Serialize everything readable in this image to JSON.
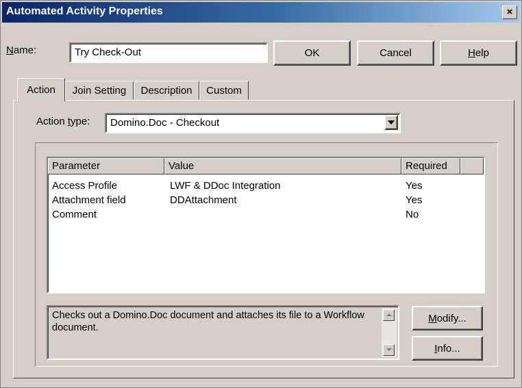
{
  "window": {
    "title": "Automated Activity Properties",
    "close_glyph": "×",
    "close_icon": "close-icon"
  },
  "name_label": {
    "accesskey": "N",
    "rest": "ame:"
  },
  "name_value": "Try Check-Out",
  "buttons": {
    "ok": "OK",
    "cancel": "Cancel",
    "help_key": "H",
    "help_rest": "elp",
    "modify_key": "M",
    "modify_rest": "odify...",
    "info_key": "I",
    "info_rest": "nfo..."
  },
  "tabs": [
    "Action",
    "Join Setting",
    "Description",
    "Custom"
  ],
  "action_type": {
    "label_pre": "Action ",
    "label_key": "t",
    "label_post": "ype:",
    "value": "Domino.Doc - Checkout"
  },
  "parameters": {
    "columns": [
      "Parameter",
      "Value",
      "Required"
    ],
    "rows": [
      {
        "parameter": "Access Profile",
        "value": "LWF & DDoc Integration",
        "required": "Yes"
      },
      {
        "parameter": "Attachment field",
        "value": "DDAttachment",
        "required": "Yes"
      },
      {
        "parameter": "Comment",
        "value": "",
        "required": "No"
      }
    ]
  },
  "description": "Checks out a Domino.Doc document and attaches its file to a Workflow document.",
  "colors": {
    "title_start": "#0a246a",
    "title_end": "#a6caf0",
    "face": "#d4d0c8"
  }
}
